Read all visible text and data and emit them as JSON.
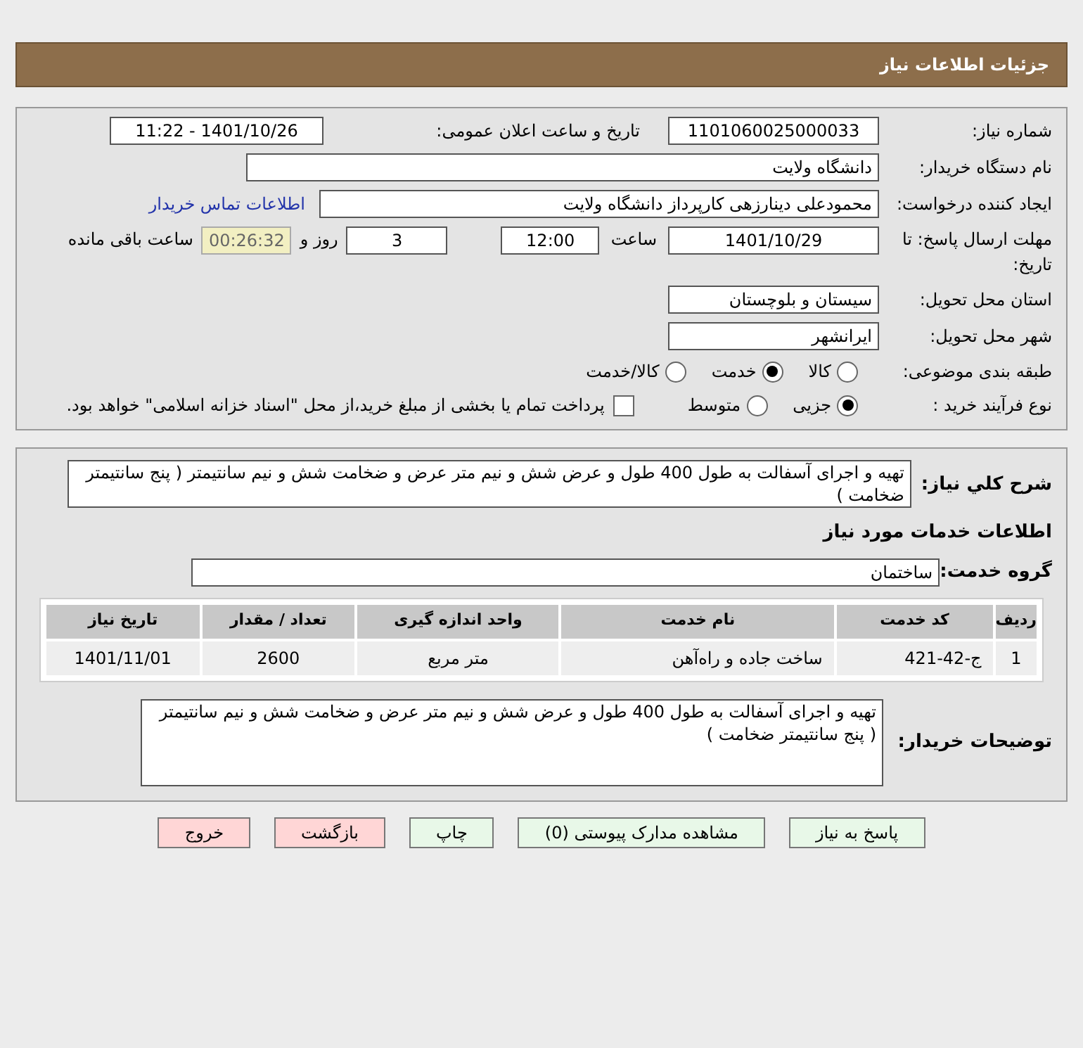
{
  "header": {
    "title": "جزئیات اطلاعات نیاز"
  },
  "details": {
    "need_number": {
      "label": "شماره نیاز:",
      "value": "1101060025000033"
    },
    "announce": {
      "label": "تاریخ و ساعت اعلان عمومی:",
      "value": "1401/10/26 - 11:22"
    },
    "buyer_org": {
      "label": "نام دستگاه خریدار:",
      "value": "دانشگاه ولایت"
    },
    "requester": {
      "label": "ایجاد کننده درخواست:",
      "value": "محمودعلی دینارزهی کارپرداز دانشگاه ولایت",
      "link": "اطلاعات تماس خریدار"
    },
    "deadline": {
      "label": "مهلت ارسال پاسخ: تا تاریخ:",
      "date": "1401/10/29",
      "time_label": "ساعت",
      "time": "12:00",
      "days": "3",
      "days_label": "روز و",
      "remaining": "00:26:32",
      "remaining_label": "ساعت باقی مانده"
    },
    "province": {
      "label": "استان محل تحویل:",
      "value": "سیستان و بلوچستان"
    },
    "city": {
      "label": "شهر محل تحویل:",
      "value": "ایرانشهر"
    },
    "category": {
      "label": "طبقه بندی موضوعی:",
      "options": [
        {
          "label": "کالا",
          "selected": false
        },
        {
          "label": "خدمت",
          "selected": true
        },
        {
          "label": "کالا/خدمت",
          "selected": false
        }
      ]
    },
    "process": {
      "label": "نوع فرآیند خرید :",
      "options": [
        {
          "label": "جزیی",
          "selected": true
        },
        {
          "label": "متوسط",
          "selected": false
        }
      ],
      "payment": {
        "checked": false,
        "text": "پرداخت تمام یا بخشی از مبلغ خرید،از محل \"اسناد خزانه اسلامی\" خواهد بود."
      }
    }
  },
  "summary": {
    "label": "شرح کلي نياز:",
    "value": "تهیه و اجرای آسفالت به طول 400 طول و عرض شش و نیم متر عرض و ضخامت شش و نیم سانتیمتر ( پنج سانتیمتر ضخامت )"
  },
  "services": {
    "heading": "اطلاعات خدمات مورد نیاز",
    "group_label": "گروه خدمت:",
    "group": "ساختمان",
    "table": {
      "columns": [
        "ردیف",
        "کد خدمت",
        "نام خدمت",
        "واحد اندازه گیری",
        "تعداد / مقدار",
        "تاریخ نیاز"
      ],
      "rows": [
        [
          "1",
          "ج-42-421",
          "ساخت جاده و راه‌آهن",
          "متر مربع",
          "2600",
          "1401/11/01"
        ]
      ]
    }
  },
  "buyer_notes": {
    "label": "توضیحات خریدار:",
    "value": "تهیه و اجرای آسفالت به طول 400 طول و عرض شش و نیم متر عرض و ضخامت شش و نیم سانتیمتر ( پنج سانتیمتر ضخامت )"
  },
  "buttons": [
    {
      "label": "پاسخ به نیاز",
      "kind": "normal"
    },
    {
      "label": "مشاهده مدارک پیوستی (0)",
      "kind": "normal"
    },
    {
      "label": "چاپ",
      "kind": "normal"
    },
    {
      "label": "بازگشت",
      "kind": "danger"
    },
    {
      "label": "خروج",
      "kind": "danger"
    }
  ]
}
